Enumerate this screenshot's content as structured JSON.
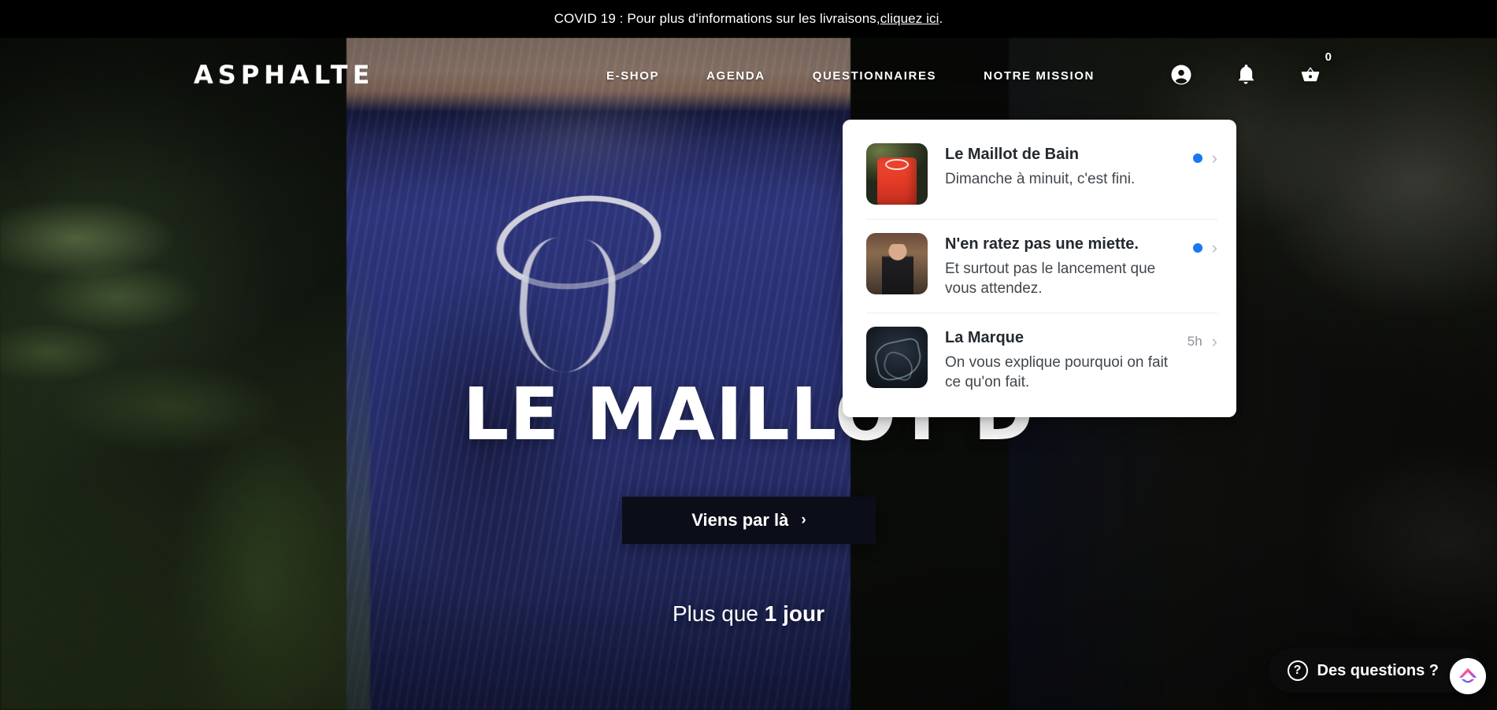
{
  "banner": {
    "text_before": "COVID 19 : Pour plus d'informations sur les livraisons, ",
    "link_label": "cliquez ici",
    "text_after": "."
  },
  "header": {
    "logo": "ASPHALTE",
    "nav": [
      {
        "label": "E-SHOP"
      },
      {
        "label": "AGENDA"
      },
      {
        "label": "QUESTIONNAIRES"
      },
      {
        "label": "NOTRE MISSION"
      }
    ],
    "icons": {
      "account": "account-circle-icon",
      "notifications": "bell-icon",
      "cart": "basket-icon"
    },
    "cart_count": "0"
  },
  "hero": {
    "title": "LE MAILLOT D",
    "cta_label": "Viens par là",
    "cta_chevron": "›",
    "countdown_prefix": "Plus que ",
    "countdown_value": "1 jour"
  },
  "notifications": [
    {
      "title": "Le Maillot de Bain",
      "description": "Dimanche à minuit, c'est fini.",
      "time": "",
      "unread": true,
      "thumb": "red-swim-shorts-thumb",
      "chevron": "›"
    },
    {
      "title": "N'en ratez pas une miette.",
      "description": "Et surtout pas le lancement que vous attendez.",
      "time": "",
      "unread": true,
      "thumb": "man-black-tshirt-thumb",
      "chevron": "›"
    },
    {
      "title": "La Marque",
      "description": "On vous explique pourquoi on fait ce qu'on fait.",
      "time": "5h",
      "unread": false,
      "thumb": "dark-map-thumb",
      "chevron": "›"
    }
  ],
  "chat": {
    "icon": "question-mark-icon",
    "label": "Des questions ?",
    "badge_icon": "crisp-chat-logo"
  },
  "colors": {
    "unread_dot": "#1877f2",
    "banner_bg": "#000000",
    "panel_bg": "#ffffff",
    "cta_bg": "#0b0e18"
  }
}
